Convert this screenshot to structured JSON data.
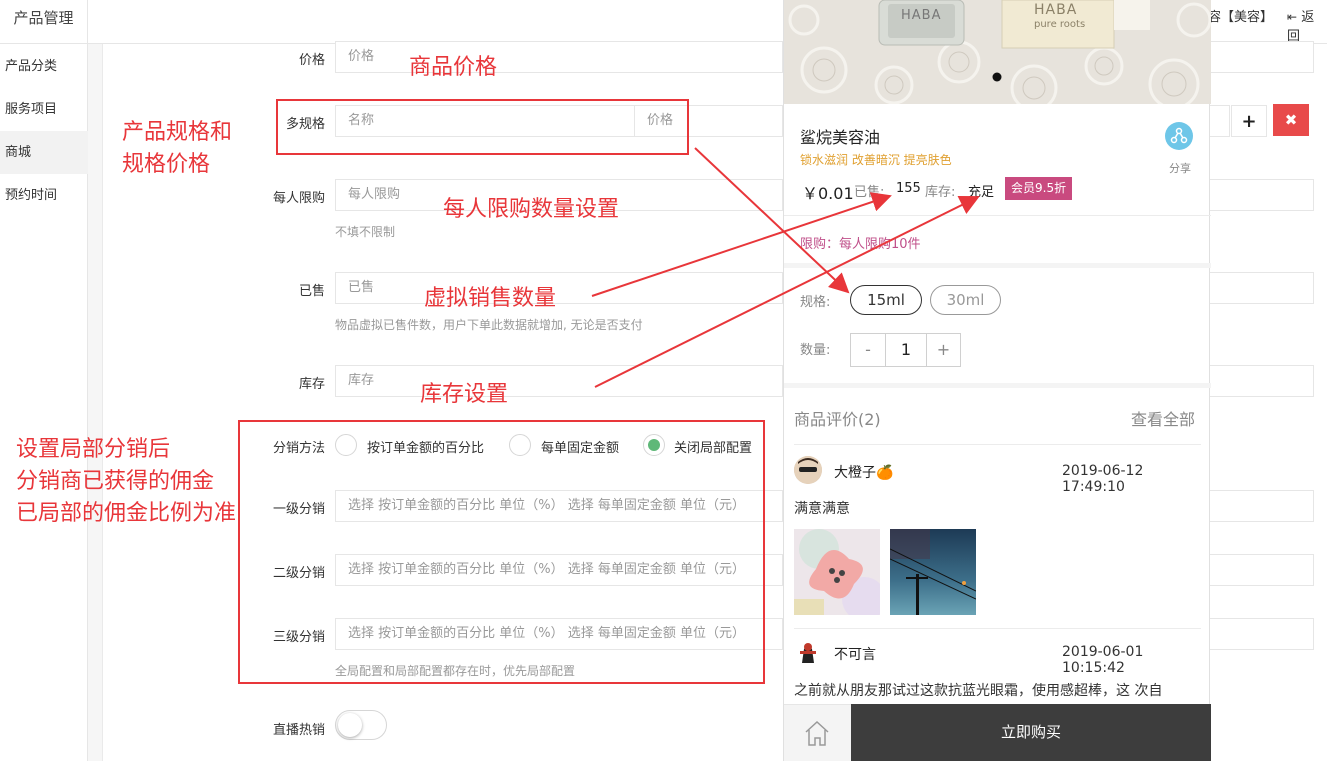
{
  "header": {
    "app_title": "产品管理",
    "right_text": "容【美容】",
    "back_label": "返回"
  },
  "sidebar": {
    "items": [
      {
        "label": "产品分类"
      },
      {
        "label": "服务项目"
      },
      {
        "label": "商城"
      },
      {
        "label": "预约时间"
      }
    ]
  },
  "form": {
    "price": {
      "label": "价格",
      "placeholder": "价格"
    },
    "multi_spec": {
      "label": "多规格",
      "name_placeholder": "名称",
      "price_placeholder": "价格"
    },
    "limit": {
      "label": "每人限购",
      "placeholder": "每人限购",
      "help": "不填不限制"
    },
    "sold": {
      "label": "已售",
      "placeholder": "已售",
      "help": "物品虚拟已售件数，用户下单此数据就增加, 无论是否支付"
    },
    "stock": {
      "label": "库存",
      "placeholder": "库存"
    },
    "distribution": {
      "label": "分销方法",
      "options": [
        "按订单金额的百分比",
        "每单固定金额",
        "关闭局部配置"
      ],
      "selected": "关闭局部配置",
      "level1_label": "一级分销",
      "level2_label": "二级分销",
      "level3_label": "三级分销",
      "level_placeholder": "选择 按订单金额的百分比 单位（%） 选择 每单固定金额 单位（元）",
      "help": "全局配置和局部配置都存在时，优先局部配置"
    },
    "live_hot": {
      "label": "直播热销",
      "enabled": false
    }
  },
  "annotations": {
    "price": "商品价格",
    "spec_line1": "产品规格和",
    "spec_line2": "规格价格",
    "limit": "每人限购数量设置",
    "sold": "虚拟销售数量",
    "stock": "库存设置",
    "dist_line1": "设置局部分销后",
    "dist_line2": "分销商已获得的佣金",
    "dist_line3": "已局部的佣金比例为准"
  },
  "preview": {
    "product_name": "鲨烷美容油",
    "subtitle": "锁水滋润 改善暗沉 提亮肤色",
    "share_label": "分享",
    "price": "￥0.01",
    "sold_label": "已售:",
    "sold_value": "155",
    "stock_label": "库存:",
    "stock_value": "充足",
    "member_badge": "会员9.5折",
    "limit_text": "限购：每人限购10件",
    "spec_label": "规格:",
    "specs": [
      "15ml",
      "30ml"
    ],
    "selected_spec": "15ml",
    "qty_label": "数量:",
    "qty_minus": "-",
    "qty_value": "1",
    "qty_plus": "+",
    "reviews_title": "商品评价(2)",
    "reviews_all": "查看全部",
    "reviews": [
      {
        "user": "大橙子🍊",
        "time": "2019-06-12 17:49:10",
        "text": "满意满意"
      },
      {
        "user": "不可言",
        "time": "2019-06-01 10:15:42",
        "text": "之前就从朋友那试过这款抗蓝光眼霜，使用感超棒，这 次自"
      }
    ],
    "buy_label": "立即购买",
    "photo_brand": "HABA",
    "photo_brand_sub": "pure roots"
  },
  "colors": {
    "accent_red": "#e8363a",
    "radio_green": "#5fb878",
    "badge_pink": "#c94a7f",
    "subtitle_orange": "#e0a030",
    "limit_pink": "#c0508a",
    "share_blue": "#6ec6e8",
    "bottom_dark": "#3d3d3d"
  },
  "icons": [
    "return-icon",
    "plus-icon",
    "close-icon",
    "share-icon",
    "home-icon"
  ]
}
